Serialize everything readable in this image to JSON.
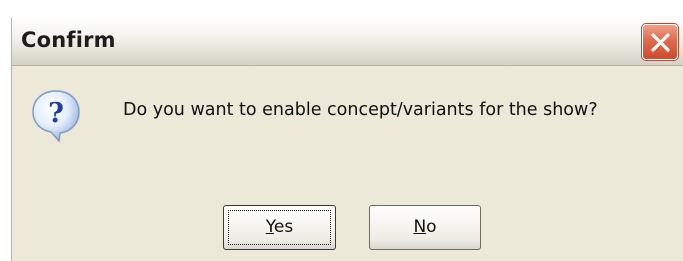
{
  "dialog": {
    "title": "Confirm",
    "message": "Do you want to enable concept/variants for the show?",
    "icon": "question-icon",
    "buttons": {
      "yes": {
        "mnemonic": "Y",
        "rest": "es"
      },
      "no": {
        "mnemonic": "N",
        "rest": "o"
      }
    },
    "colors": {
      "face": "#ece9d8",
      "close": "#d9553a"
    }
  }
}
